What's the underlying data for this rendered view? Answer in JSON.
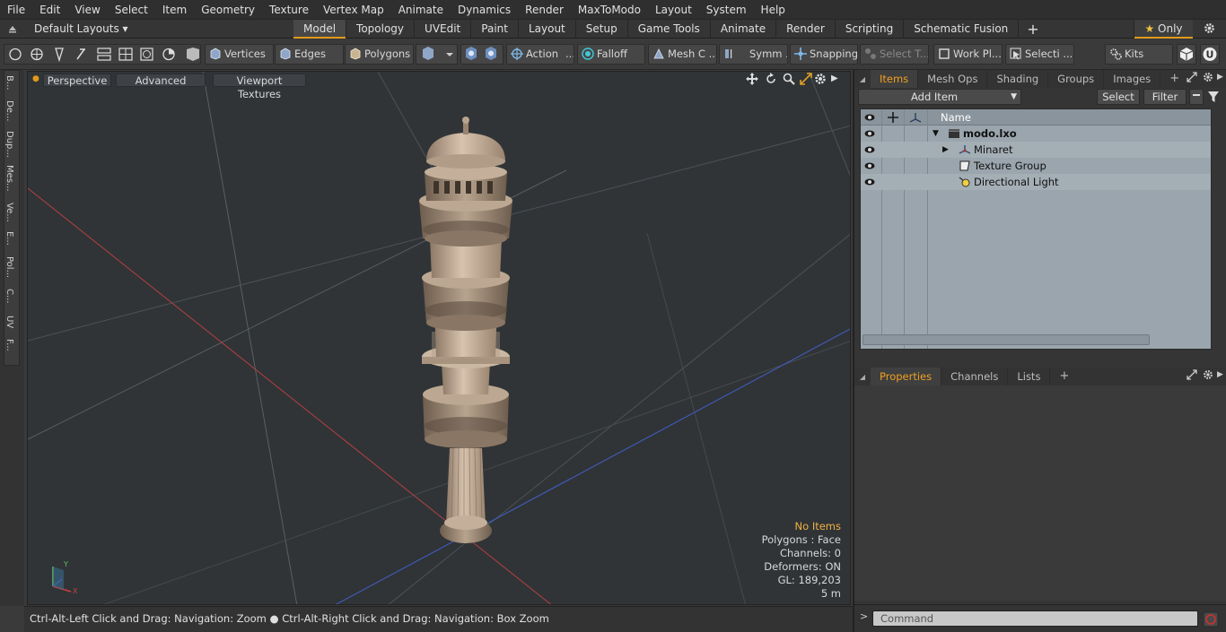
{
  "menu": [
    "File",
    "Edit",
    "View",
    "Select",
    "Item",
    "Geometry",
    "Texture",
    "Vertex Map",
    "Animate",
    "Dynamics",
    "Render",
    "MaxToModo",
    "Layout",
    "System",
    "Help"
  ],
  "layout_selector": "Default Layouts",
  "layout_tabs": [
    "Model",
    "Topology",
    "UVEdit",
    "Paint",
    "Layout",
    "Setup",
    "Game Tools",
    "Animate",
    "Render",
    "Scripting",
    "Schematic Fusion"
  ],
  "layout_only": "Only",
  "toolbar": {
    "vertices": "Vertices",
    "edges": "Edges",
    "polygons": "Polygons",
    "action": "Action",
    "falloff": "Falloff",
    "mesh_c": "Mesh C ...",
    "symm": "Symm ...",
    "snapping": "Snapping",
    "select_t": "Select T...",
    "work_pl": "Work Pl...",
    "selecti": "Selecti ...",
    "kits": "Kits"
  },
  "left_tabs": [
    "B...",
    "De...",
    "Dup...",
    "Mes...",
    "Ve...",
    "E...",
    "Pol...",
    "C...",
    "UV",
    "F..."
  ],
  "viewport": {
    "perspective": "Perspective",
    "advanced": "Advanced",
    "viewport_textures": "Viewport Textures",
    "info": {
      "no_items": "No Items",
      "polygons": "Polygons : Face",
      "channels": "Channels: 0",
      "deformers": "Deformers: ON",
      "gl": "GL: 189,203",
      "scale": "5 m"
    }
  },
  "status": "Ctrl-Alt-Left Click and Drag: Navigation: Zoom ● Ctrl-Alt-Right Click and Drag: Navigation: Box Zoom",
  "items_panel": {
    "tabs": [
      "Items",
      "Mesh Ops",
      "Shading",
      "Groups",
      "Images"
    ],
    "add_item": "Add Item",
    "select": "Select",
    "filter": "Filter",
    "name_header": "Name",
    "rows": [
      {
        "name": "modo.lxo"
      },
      {
        "name": "Minaret"
      },
      {
        "name": "Texture Group"
      },
      {
        "name": "Directional Light"
      }
    ]
  },
  "properties_panel": {
    "tabs": [
      "Properties",
      "Channels",
      "Lists"
    ]
  },
  "command_placeholder": "Command",
  "colors": {
    "accent": "#f0a020",
    "item_list_bg": "#9aa5ad"
  }
}
